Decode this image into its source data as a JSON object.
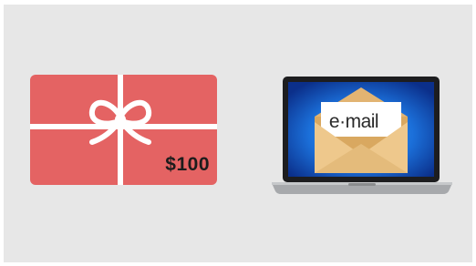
{
  "gift_card": {
    "amount": "$100",
    "card_color": "#e46363",
    "ribbon_color": "#ffffff",
    "icon": "gift-card-icon"
  },
  "laptop": {
    "email_text": "e·mail",
    "screen_color": "#1b6fd9",
    "envelope_color": "#e6bd7a",
    "icon": "laptop-email-icon"
  },
  "colors": {
    "background": "#e7e7e7"
  }
}
